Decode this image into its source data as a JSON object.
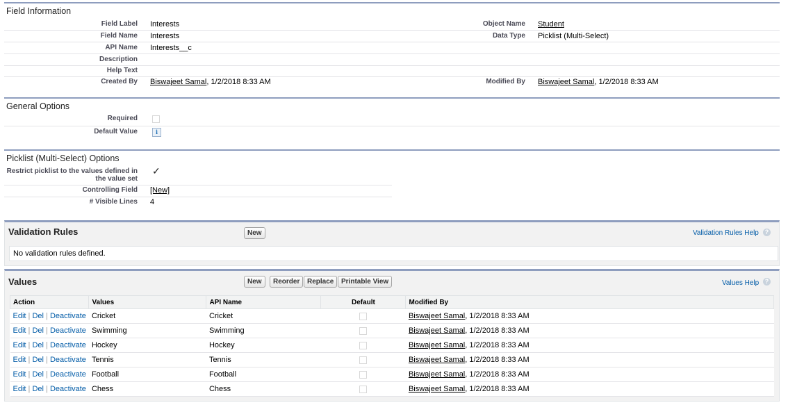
{
  "field_info": {
    "title": "Field Information",
    "field_label_label": "Field Label",
    "field_label_value": "Interests",
    "object_name_label": "Object Name",
    "object_name_value": "Student",
    "field_name_label": "Field Name",
    "field_name_value": "Interests",
    "data_type_label": "Data Type",
    "data_type_value": "Picklist (Multi-Select)",
    "api_name_label": "API Name",
    "api_name_value": "Interests__c",
    "description_label": "Description",
    "help_text_label": "Help Text",
    "created_by_label": "Created By",
    "created_by_user": "Biswajeet Samal",
    "created_by_date": ", 1/2/2018 8:33 AM",
    "modified_by_label": "Modified By",
    "modified_by_user": "Biswajeet Samal",
    "modified_by_date": ", 1/2/2018 8:33 AM"
  },
  "general_options": {
    "title": "General Options",
    "required_label": "Required",
    "required_checked": false,
    "default_value_label": "Default Value"
  },
  "picklist_options": {
    "title": "Picklist (Multi-Select) Options",
    "restrict_label_line1": "Restrict picklist to the values defined in",
    "restrict_label_line2": "the value set",
    "restrict_checked": true,
    "controlling_field_label": "Controlling Field",
    "controlling_field_link": "[New]",
    "visible_lines_label": "# Visible Lines",
    "visible_lines_value": "4"
  },
  "validation_rules": {
    "title": "Validation Rules",
    "new_button": "New",
    "help_link": "Validation Rules Help",
    "empty_message": "No validation rules defined."
  },
  "values_section": {
    "title": "Values",
    "buttons": {
      "new": "New",
      "reorder": "Reorder",
      "replace": "Replace",
      "printable_view": "Printable View"
    },
    "help_link": "Values Help",
    "columns": {
      "action": "Action",
      "values": "Values",
      "api_name": "API Name",
      "default": "Default",
      "modified_by": "Modified By"
    },
    "action_labels": {
      "edit": "Edit",
      "del": "Del",
      "deactivate": "Deactivate",
      "separator": "|"
    },
    "rows": [
      {
        "value": "Cricket",
        "api_name": "Cricket",
        "default": false,
        "modified_user": "Biswajeet Samal",
        "modified_date": ", 1/2/2018 8:33 AM"
      },
      {
        "value": "Swimming",
        "api_name": "Swimming",
        "default": false,
        "modified_user": "Biswajeet Samal",
        "modified_date": ", 1/2/2018 8:33 AM"
      },
      {
        "value": "Hockey",
        "api_name": "Hockey",
        "default": false,
        "modified_user": "Biswajeet Samal",
        "modified_date": ", 1/2/2018 8:33 AM"
      },
      {
        "value": "Tennis",
        "api_name": "Tennis",
        "default": false,
        "modified_user": "Biswajeet Samal",
        "modified_date": ", 1/2/2018 8:33 AM"
      },
      {
        "value": "Football",
        "api_name": "Football",
        "default": false,
        "modified_user": "Biswajeet Samal",
        "modified_date": ", 1/2/2018 8:33 AM"
      },
      {
        "value": "Chess",
        "api_name": "Chess",
        "default": false,
        "modified_user": "Biswajeet Samal",
        "modified_date": ", 1/2/2018 8:33 AM"
      }
    ]
  },
  "icons": {
    "info": "i",
    "help": "?",
    "check": "✓"
  }
}
